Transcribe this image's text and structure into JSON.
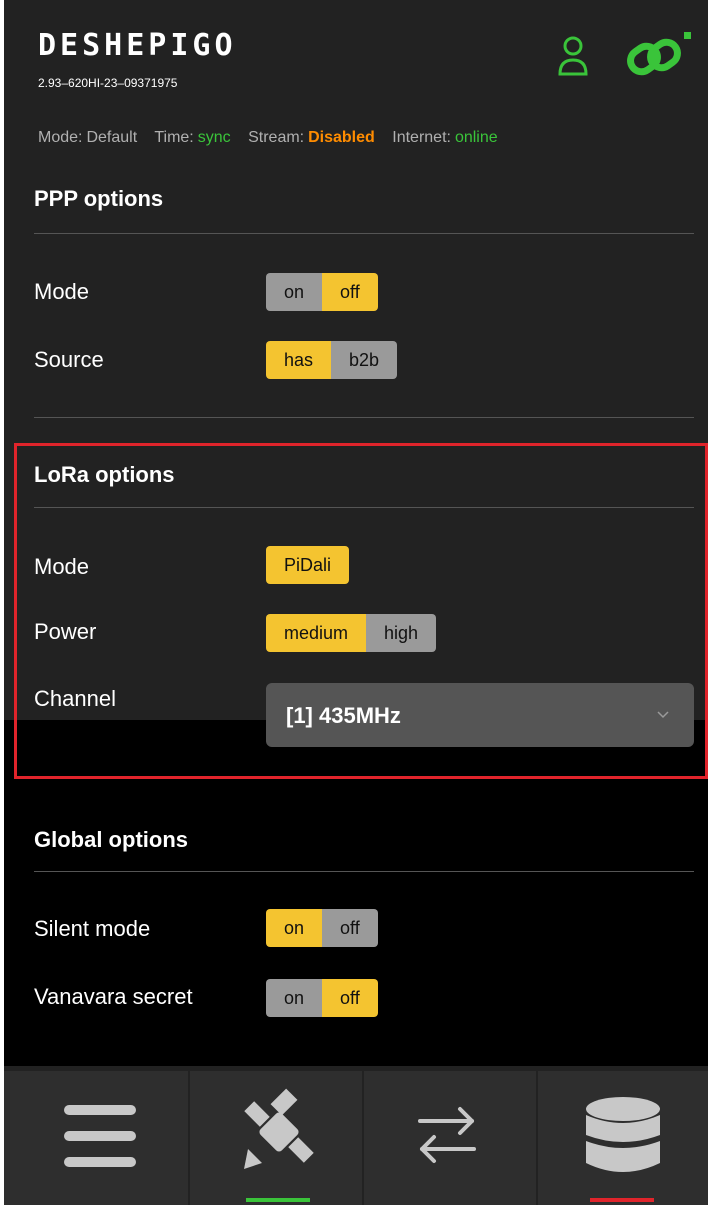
{
  "header": {
    "logo": "DESHEPIGO",
    "serial": "2.93–620HI-23–09371975",
    "icons": {
      "user": "user-icon",
      "link": "link-icon"
    }
  },
  "status": {
    "mode_label": "Mode:",
    "mode_value": "Default",
    "time_label": "Time:",
    "time_value": "sync",
    "stream_label": "Stream:",
    "stream_value": "Disabled",
    "internet_label": "Internet:",
    "internet_value": "online"
  },
  "ppp": {
    "title": "PPP options",
    "mode": {
      "label": "Mode",
      "options": [
        "on",
        "off"
      ],
      "selected": "off"
    },
    "source": {
      "label": "Source",
      "options": [
        "has",
        "b2b"
      ],
      "selected": "has"
    }
  },
  "lora": {
    "title": "LoRa options",
    "mode": {
      "label": "Mode",
      "options": [
        "PiDali"
      ],
      "selected": "PiDali"
    },
    "power": {
      "label": "Power",
      "options": [
        "medium",
        "high"
      ],
      "selected": "medium"
    },
    "channel": {
      "label": "Channel",
      "value": "[1] 435MHz"
    }
  },
  "global": {
    "title": "Global options",
    "silent": {
      "label": "Silent mode",
      "options": [
        "on",
        "off"
      ],
      "selected": "on"
    },
    "vanavara": {
      "label": "Vanavara secret",
      "options": [
        "on",
        "off"
      ],
      "selected": "off"
    }
  },
  "nav": {
    "items": [
      "menu-icon",
      "satellite-icon",
      "transfer-icon",
      "database-icon"
    ],
    "active_color": "#3ac43a",
    "alert_color": "#e0242b"
  },
  "colors": {
    "accent": "#f4c430",
    "highlight_border": "#e0242b",
    "online": "#3ac43a",
    "disabled": "#ff8c00"
  }
}
